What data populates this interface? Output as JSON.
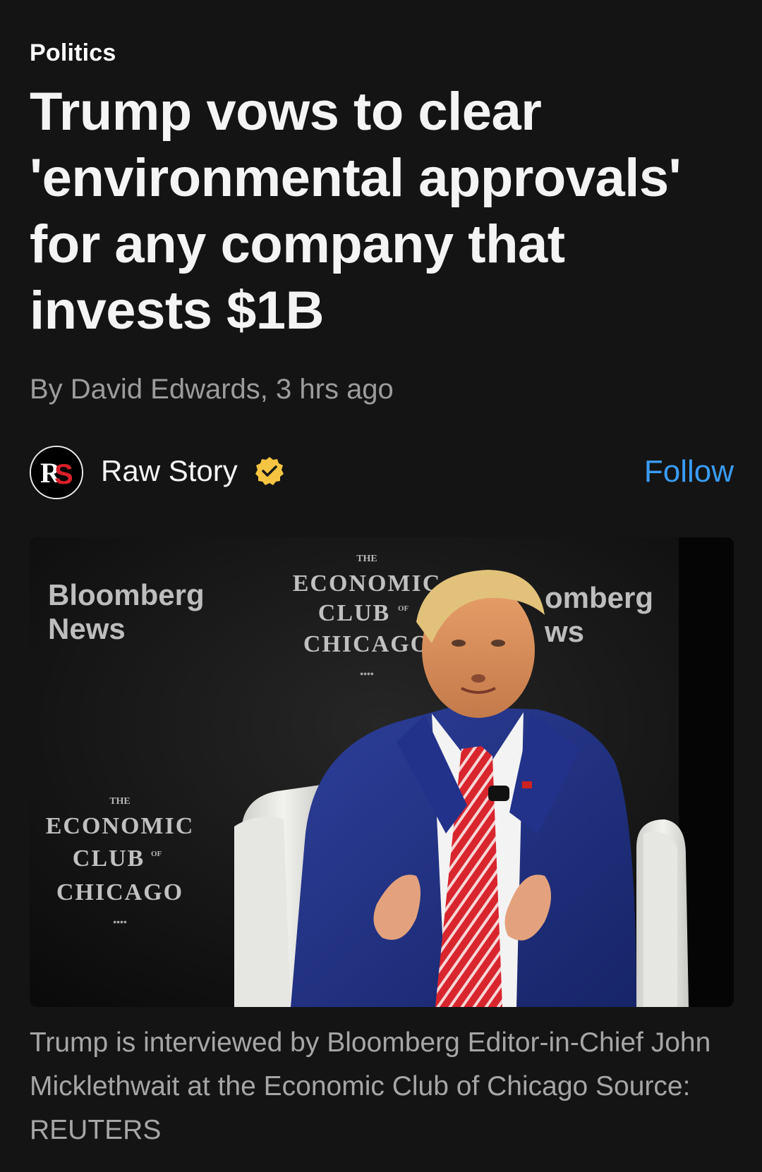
{
  "article": {
    "category": "Politics",
    "headline": "Trump vows to clear 'environmental approvals' for any company that invests $1B",
    "byline": "By David Edwards, 3 hrs ago",
    "caption": "Trump is interviewed by Bloomberg Editor-in-Chief John Micklethwait at the Economic Club of Chicago Source: REUTERS"
  },
  "source": {
    "name": "Raw Story",
    "logo_text": "RS",
    "verified": true,
    "follow_label": "Follow"
  },
  "photo": {
    "backdrop_left_brand": "Bloomberg News",
    "backdrop_left_brand_line1": "Bloomberg",
    "backdrop_left_brand_line2": "News",
    "backdrop_right_brand_line1": "omberg",
    "backdrop_right_brand_line2": "ws",
    "club_small": "THE",
    "club_line1": "ECONOMIC",
    "club_line2": "CLUB",
    "club_of": "OF",
    "club_line3": "CHICAGO",
    "club_dots": "••••"
  },
  "colors": {
    "background": "#141414",
    "accent_follow": "#3a9cf4",
    "verified_badge": "#f5c542",
    "muted_text": "#9c9c9c"
  }
}
